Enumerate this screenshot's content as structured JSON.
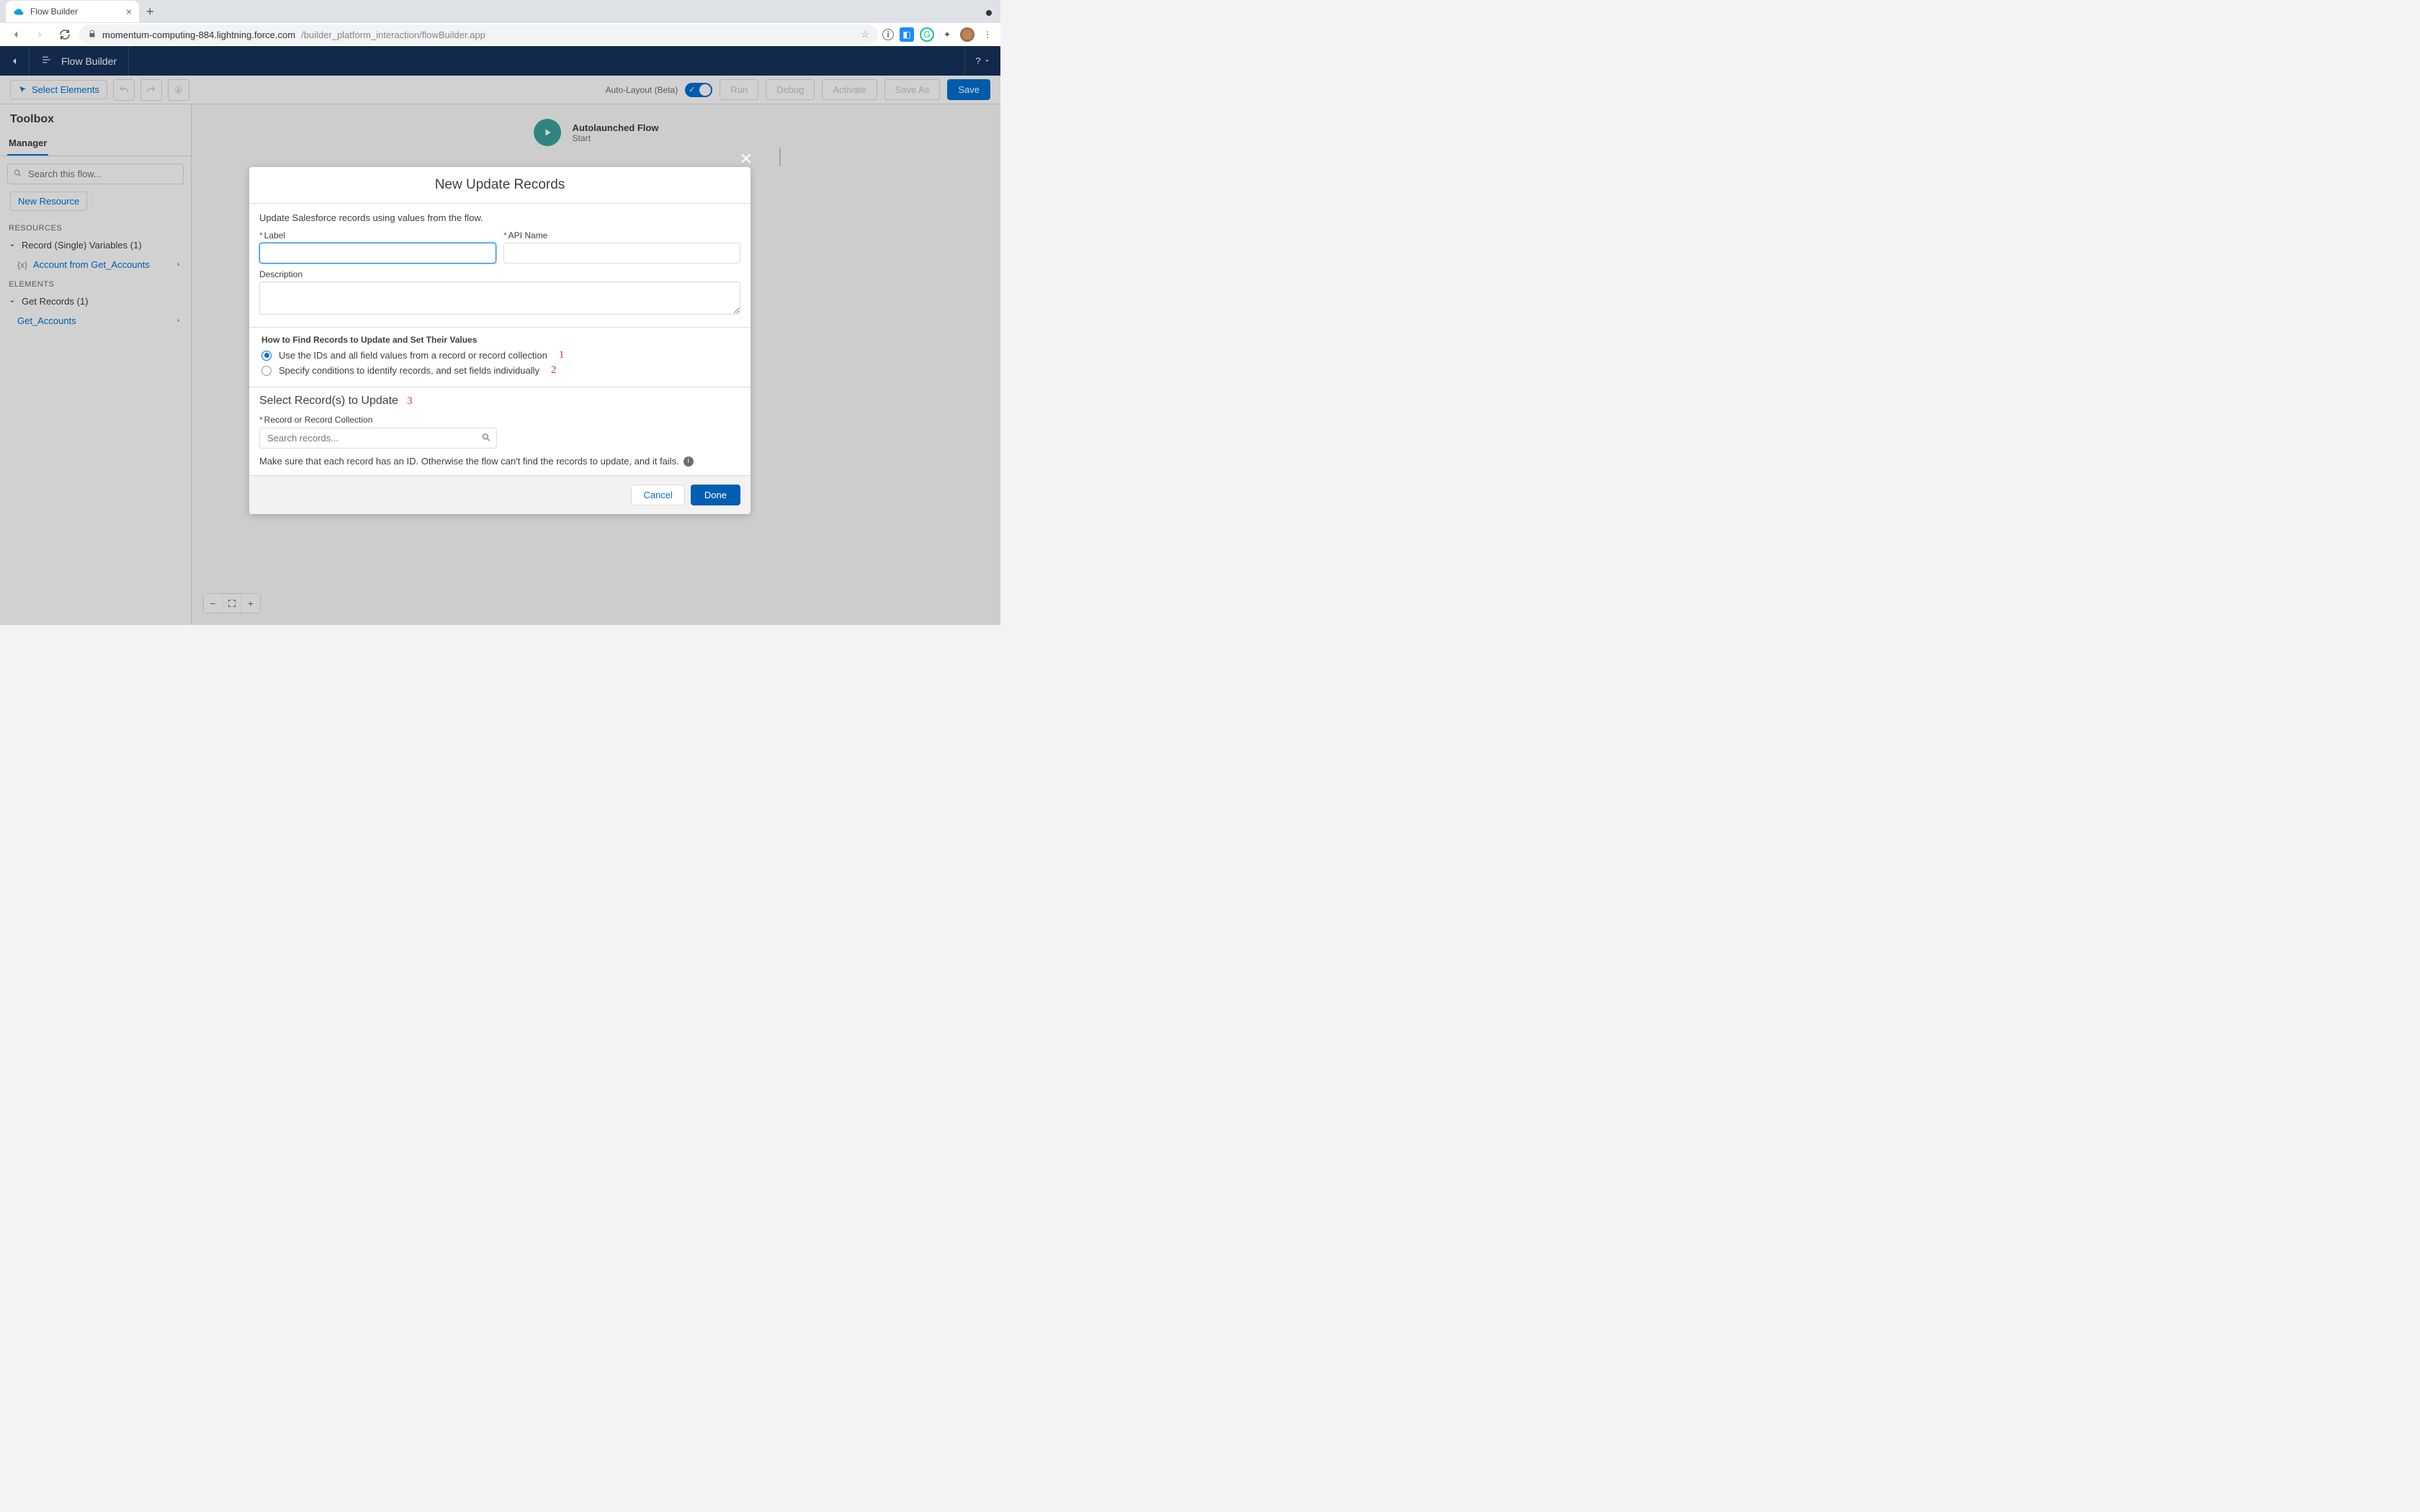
{
  "browser": {
    "tab_title": "Flow Builder",
    "url_host": "momentum-computing-884.lightning.force.com",
    "url_path": "/builder_platform_interaction/flowBuilder.app"
  },
  "appbar": {
    "title": "Flow Builder"
  },
  "toolbar": {
    "select_elements": "Select Elements",
    "auto_layout_label": "Auto-Layout (Beta)",
    "run": "Run",
    "debug": "Debug",
    "activate": "Activate",
    "save_as": "Save As",
    "save": "Save"
  },
  "sidebar": {
    "title": "Toolbox",
    "tab": "Manager",
    "search_placeholder": "Search this flow...",
    "new_resource": "New Resource",
    "sections": {
      "resources_label": "RESOURCES",
      "record_vars_header": "Record (Single) Variables (1)",
      "record_var_item": "Account from Get_Accounts",
      "elements_label": "ELEMENTS",
      "get_records_header": "Get Records (1)",
      "get_records_item": "Get_Accounts"
    }
  },
  "canvas": {
    "node_title": "Autolaunched Flow",
    "node_subtitle": "Start"
  },
  "modal": {
    "title": "New Update Records",
    "intro": "Update Salesforce records using values from the flow.",
    "label_field": "Label",
    "api_name_field": "API Name",
    "description_field": "Description",
    "find_section_title": "How to Find Records to Update and Set Their Values",
    "radio1": "Use the IDs and all field values from a record or record collection",
    "radio2": "Specify conditions to identify records, and set fields individually",
    "annotation_1": "1",
    "annotation_2": "2",
    "annotation_3": "3",
    "select_section_title": "Select Record(s) to Update",
    "record_coll_label": "Record or Record Collection",
    "search_records_placeholder": "Search records...",
    "help_note": "Make sure that each record has an ID. Otherwise the flow can't find the records to update, and it fails.",
    "cancel": "Cancel",
    "done": "Done"
  }
}
